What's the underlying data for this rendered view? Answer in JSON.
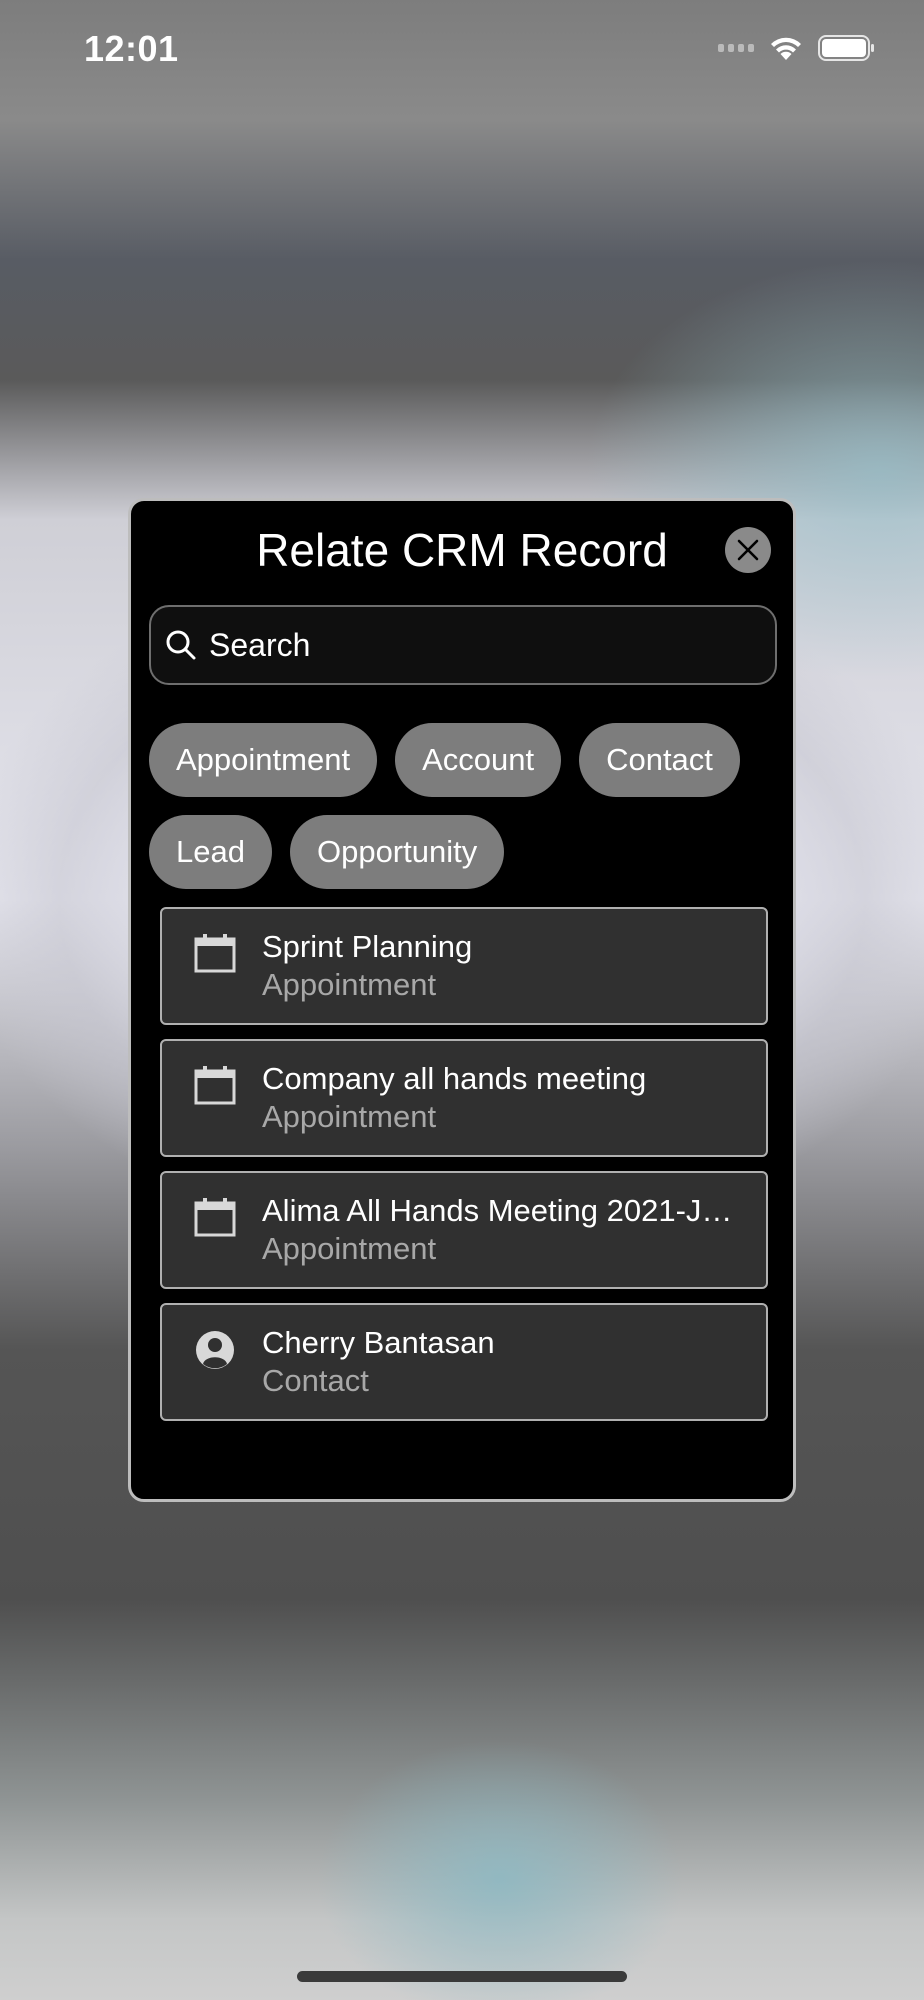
{
  "status_bar": {
    "time": "12:01"
  },
  "modal": {
    "title": "Relate CRM Record",
    "search": {
      "placeholder": "Search",
      "value": ""
    },
    "filters": {
      "row1": [
        {
          "label": "Appointment"
        },
        {
          "label": "Account"
        },
        {
          "label": "Contact"
        }
      ],
      "row2": [
        {
          "label": "Lead"
        },
        {
          "label": "Opportunity"
        }
      ]
    },
    "records": [
      {
        "title": "Sprint Planning",
        "type": "Appointment",
        "icon": "calendar-icon"
      },
      {
        "title": "Company all hands meeting",
        "type": "Appointment",
        "icon": "calendar-icon"
      },
      {
        "title": "Alima All Hands Meeting 2021-J…",
        "type": "Appointment",
        "icon": "calendar-icon"
      },
      {
        "title": "Cherry Bantasan",
        "type": "Contact",
        "icon": "person-icon"
      }
    ]
  },
  "colors": {
    "modal_bg": "#000000",
    "chip_bg": "#7d7d7d",
    "item_bg": "#303030",
    "subtitle": "#a8a8a8"
  }
}
